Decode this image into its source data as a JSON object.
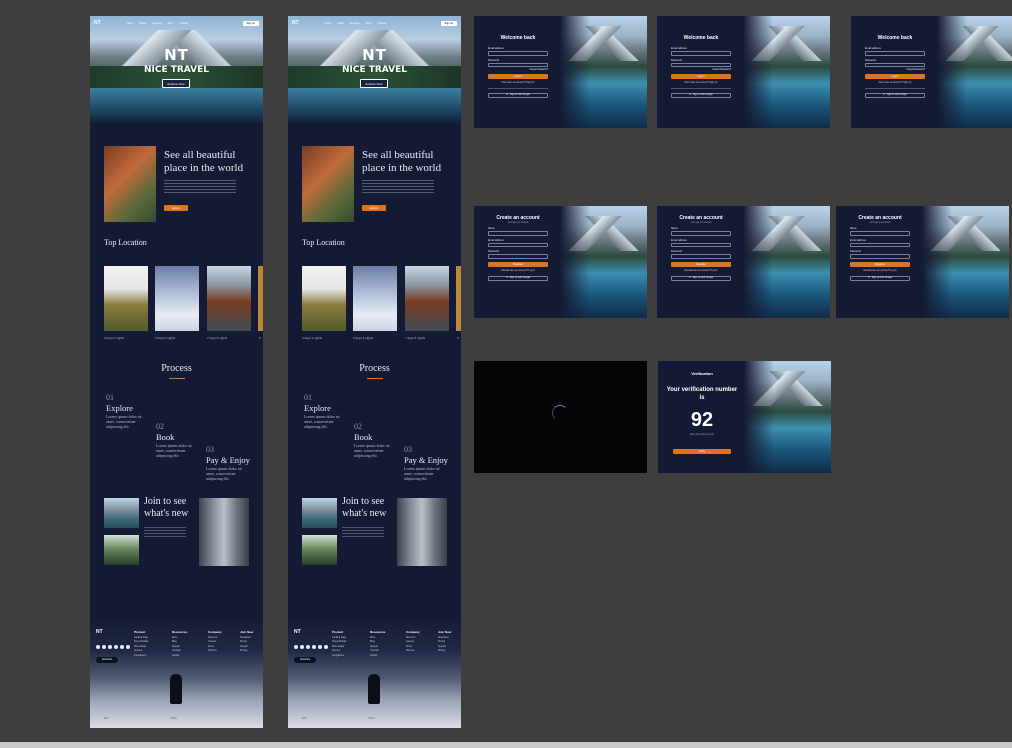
{
  "landing": {
    "logo": "NT",
    "nav_links": [
      "Home",
      "About",
      "Services",
      "Tours",
      "Contact"
    ],
    "nav_button": "Sign up",
    "brand_line1": "NT",
    "brand_line2": "NICE TRAVEL",
    "explore_button": "Explore Now",
    "feature_title": "See all beautiful place in the world",
    "feature_button": "Explore",
    "top_location": "Top Location",
    "locations": [
      "3 days 2 nights",
      "5 days 3 nights",
      "7 days 6 nights",
      "6"
    ],
    "process_title": "Process",
    "steps": [
      {
        "num": "01",
        "title": "Explore",
        "text": "Lorem ipsum dolor sit amet, consectetuer adipiscing elit."
      },
      {
        "num": "02",
        "title": "Book",
        "text": "Lorem ipsum dolor sit amet, consectetuer adipiscing elit."
      },
      {
        "num": "03",
        "title": "Pay & Enjoy",
        "text": "Lorem ipsum dolor sit amet, consectetuer adipiscing elit."
      }
    ],
    "join_title": "Join to see what's new",
    "footer": {
      "logo": "NT",
      "columns": [
        {
          "heading": "Product",
          "items": [
            "Landing Page",
            "Popup Builder",
            "Web-design",
            "Content",
            "Integrations"
          ]
        },
        {
          "heading": "Resources",
          "items": [
            "Docs",
            "Blog",
            "Support",
            "Tutorials",
            "Guides"
          ]
        },
        {
          "heading": "Company",
          "items": [
            "About Us",
            "Careers",
            "Press",
            "Partners"
          ]
        },
        {
          "heading": "Join Now",
          "items": [
            "Newsletter",
            "Pricing",
            "Support",
            "Privacy"
          ]
        }
      ],
      "subscribe": "Subscribe",
      "payments": [
        "EPI",
        "VISA"
      ]
    }
  },
  "auth": {
    "login_title": "Welcome back",
    "email_label": "Email address",
    "password_label": "Password",
    "forgot": "Forgot Password?",
    "login_button": "Log In",
    "no_account": "Don't have an account? Sign Up",
    "google": "Sign in with Google",
    "register_title": "Create an account",
    "register_sub": "Let's get you started",
    "name_label": "Name",
    "register_button": "Register",
    "have_account": "Already have an account? Log In",
    "google_up": "Sign up with Google"
  },
  "verify": {
    "title": "Verification",
    "heading": "Your verification number is",
    "number": "92",
    "sub": "Enter this code to verify",
    "button": "Verify"
  }
}
